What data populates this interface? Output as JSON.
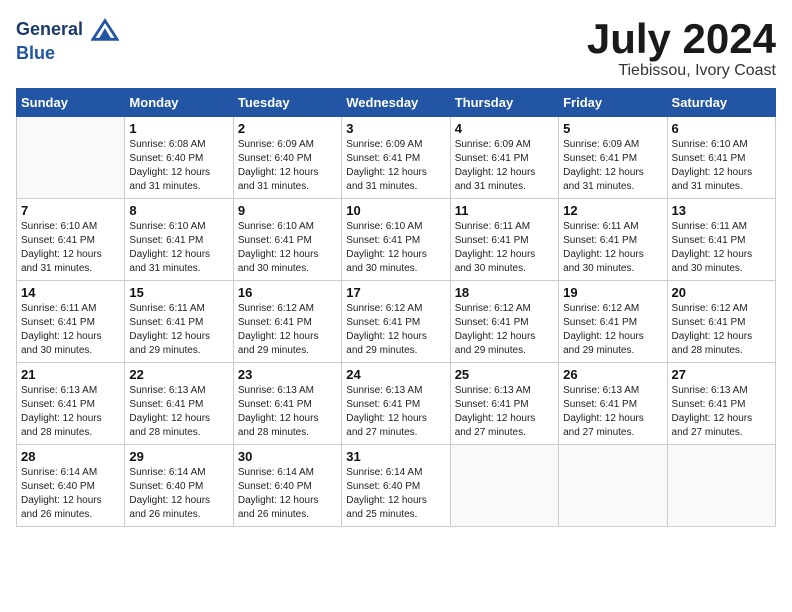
{
  "header": {
    "logo_line1": "General",
    "logo_line2": "Blue",
    "month_title": "July 2024",
    "location": "Tiebissou, Ivory Coast"
  },
  "days_of_week": [
    "Sunday",
    "Monday",
    "Tuesday",
    "Wednesday",
    "Thursday",
    "Friday",
    "Saturday"
  ],
  "weeks": [
    [
      {
        "day": "",
        "sunrise": "",
        "sunset": "",
        "daylight": ""
      },
      {
        "day": "1",
        "sunrise": "6:08 AM",
        "sunset": "6:40 PM",
        "daylight": "12 hours and 31 minutes."
      },
      {
        "day": "2",
        "sunrise": "6:09 AM",
        "sunset": "6:40 PM",
        "daylight": "12 hours and 31 minutes."
      },
      {
        "day": "3",
        "sunrise": "6:09 AM",
        "sunset": "6:41 PM",
        "daylight": "12 hours and 31 minutes."
      },
      {
        "day": "4",
        "sunrise": "6:09 AM",
        "sunset": "6:41 PM",
        "daylight": "12 hours and 31 minutes."
      },
      {
        "day": "5",
        "sunrise": "6:09 AM",
        "sunset": "6:41 PM",
        "daylight": "12 hours and 31 minutes."
      },
      {
        "day": "6",
        "sunrise": "6:10 AM",
        "sunset": "6:41 PM",
        "daylight": "12 hours and 31 minutes."
      }
    ],
    [
      {
        "day": "7",
        "sunrise": "6:10 AM",
        "sunset": "6:41 PM",
        "daylight": "12 hours and 31 minutes."
      },
      {
        "day": "8",
        "sunrise": "6:10 AM",
        "sunset": "6:41 PM",
        "daylight": "12 hours and 31 minutes."
      },
      {
        "day": "9",
        "sunrise": "6:10 AM",
        "sunset": "6:41 PM",
        "daylight": "12 hours and 30 minutes."
      },
      {
        "day": "10",
        "sunrise": "6:10 AM",
        "sunset": "6:41 PM",
        "daylight": "12 hours and 30 minutes."
      },
      {
        "day": "11",
        "sunrise": "6:11 AM",
        "sunset": "6:41 PM",
        "daylight": "12 hours and 30 minutes."
      },
      {
        "day": "12",
        "sunrise": "6:11 AM",
        "sunset": "6:41 PM",
        "daylight": "12 hours and 30 minutes."
      },
      {
        "day": "13",
        "sunrise": "6:11 AM",
        "sunset": "6:41 PM",
        "daylight": "12 hours and 30 minutes."
      }
    ],
    [
      {
        "day": "14",
        "sunrise": "6:11 AM",
        "sunset": "6:41 PM",
        "daylight": "12 hours and 30 minutes."
      },
      {
        "day": "15",
        "sunrise": "6:11 AM",
        "sunset": "6:41 PM",
        "daylight": "12 hours and 29 minutes."
      },
      {
        "day": "16",
        "sunrise": "6:12 AM",
        "sunset": "6:41 PM",
        "daylight": "12 hours and 29 minutes."
      },
      {
        "day": "17",
        "sunrise": "6:12 AM",
        "sunset": "6:41 PM",
        "daylight": "12 hours and 29 minutes."
      },
      {
        "day": "18",
        "sunrise": "6:12 AM",
        "sunset": "6:41 PM",
        "daylight": "12 hours and 29 minutes."
      },
      {
        "day": "19",
        "sunrise": "6:12 AM",
        "sunset": "6:41 PM",
        "daylight": "12 hours and 29 minutes."
      },
      {
        "day": "20",
        "sunrise": "6:12 AM",
        "sunset": "6:41 PM",
        "daylight": "12 hours and 28 minutes."
      }
    ],
    [
      {
        "day": "21",
        "sunrise": "6:13 AM",
        "sunset": "6:41 PM",
        "daylight": "12 hours and 28 minutes."
      },
      {
        "day": "22",
        "sunrise": "6:13 AM",
        "sunset": "6:41 PM",
        "daylight": "12 hours and 28 minutes."
      },
      {
        "day": "23",
        "sunrise": "6:13 AM",
        "sunset": "6:41 PM",
        "daylight": "12 hours and 28 minutes."
      },
      {
        "day": "24",
        "sunrise": "6:13 AM",
        "sunset": "6:41 PM",
        "daylight": "12 hours and 27 minutes."
      },
      {
        "day": "25",
        "sunrise": "6:13 AM",
        "sunset": "6:41 PM",
        "daylight": "12 hours and 27 minutes."
      },
      {
        "day": "26",
        "sunrise": "6:13 AM",
        "sunset": "6:41 PM",
        "daylight": "12 hours and 27 minutes."
      },
      {
        "day": "27",
        "sunrise": "6:13 AM",
        "sunset": "6:41 PM",
        "daylight": "12 hours and 27 minutes."
      }
    ],
    [
      {
        "day": "28",
        "sunrise": "6:14 AM",
        "sunset": "6:40 PM",
        "daylight": "12 hours and 26 minutes."
      },
      {
        "day": "29",
        "sunrise": "6:14 AM",
        "sunset": "6:40 PM",
        "daylight": "12 hours and 26 minutes."
      },
      {
        "day": "30",
        "sunrise": "6:14 AM",
        "sunset": "6:40 PM",
        "daylight": "12 hours and 26 minutes."
      },
      {
        "day": "31",
        "sunrise": "6:14 AM",
        "sunset": "6:40 PM",
        "daylight": "12 hours and 25 minutes."
      },
      {
        "day": "",
        "sunrise": "",
        "sunset": "",
        "daylight": ""
      },
      {
        "day": "",
        "sunrise": "",
        "sunset": "",
        "daylight": ""
      },
      {
        "day": "",
        "sunrise": "",
        "sunset": "",
        "daylight": ""
      }
    ]
  ],
  "labels": {
    "sunrise_prefix": "Sunrise: ",
    "sunset_prefix": "Sunset: ",
    "daylight_prefix": "Daylight: "
  }
}
